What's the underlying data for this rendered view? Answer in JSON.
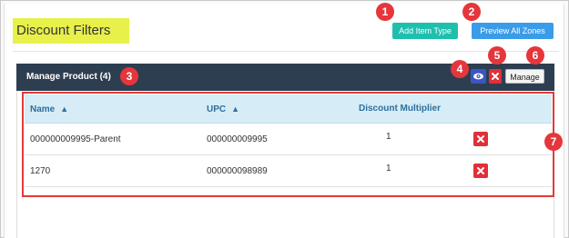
{
  "header": {
    "page_title": "Discount Filters",
    "add_item_type_label": "Add Item Type",
    "preview_all_zones_label": "Preview All Zones"
  },
  "panel": {
    "title": "Manage Product (4)",
    "manage_label": "Manage",
    "view_icon": "eye-icon",
    "delete_icon": "close-icon"
  },
  "table": {
    "columns": [
      {
        "label": "Name",
        "sortable": true
      },
      {
        "label": "UPC",
        "sortable": true
      },
      {
        "label": "Discount Multiplier",
        "sortable": false
      }
    ],
    "rows": [
      {
        "name": "000000009995-Parent",
        "upc": "000000009995",
        "discount_multiplier": "1"
      },
      {
        "name": "1270",
        "upc": "000000098989",
        "discount_multiplier": "1"
      }
    ]
  },
  "callouts": [
    "1",
    "2",
    "3",
    "4",
    "5",
    "6",
    "7"
  ],
  "colors": {
    "title_highlight": "#e8f04a",
    "teal_button": "#1fbfae",
    "blue_button": "#3a9ce8",
    "panel_header": "#2d3e50",
    "table_header": "#d6ecf6",
    "danger": "#e0303a",
    "callout": "#e5363b"
  }
}
